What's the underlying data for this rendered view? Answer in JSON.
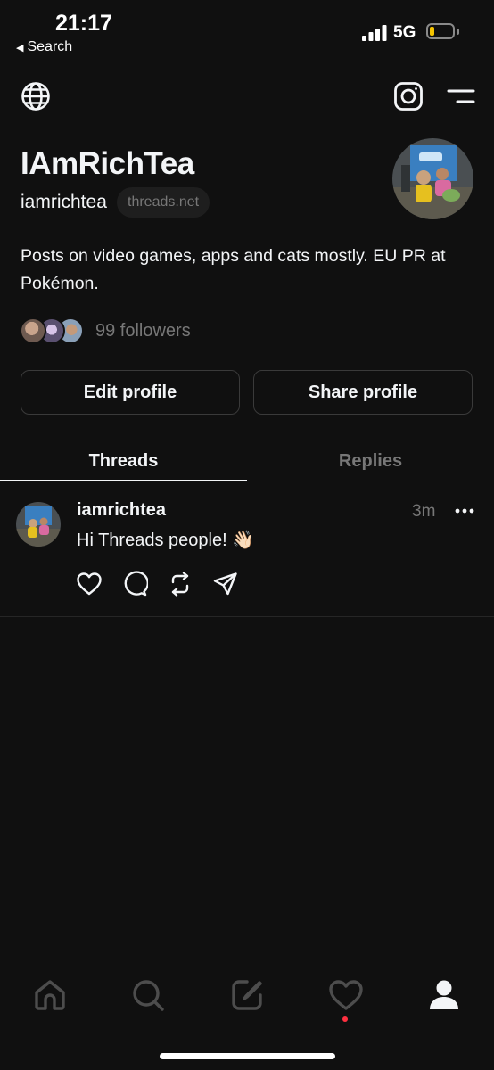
{
  "status_bar": {
    "time": "21:17",
    "back_label": "Search",
    "network": "5G"
  },
  "toolbar": {
    "left_icon": "globe-icon",
    "right_icons": [
      "instagram-icon",
      "menu-icon"
    ]
  },
  "profile": {
    "display_name": "IAmRichTea",
    "username": "iamrichtea",
    "domain": "threads.net",
    "bio": "Posts on video games, apps and cats mostly. EU PR at Pokémon.",
    "followers": "99 followers"
  },
  "actions": {
    "edit_label": "Edit profile",
    "share_label": "Share profile"
  },
  "tabs": [
    {
      "label": "Threads",
      "active": true
    },
    {
      "label": "Replies",
      "active": false
    }
  ],
  "post": {
    "username": "iamrichtea",
    "time": "3m",
    "text": "Hi Threads people! 👋🏻"
  },
  "bottom_nav": {
    "items": [
      "home-icon",
      "search-icon",
      "compose-icon",
      "activity-icon",
      "profile-icon"
    ],
    "active": "profile-icon"
  },
  "colors": {
    "background": "#101010",
    "text_primary": "#f3f5f7",
    "text_secondary": "#777777",
    "notification_dot": "#ff3040",
    "battery_level": "#f5c400"
  }
}
